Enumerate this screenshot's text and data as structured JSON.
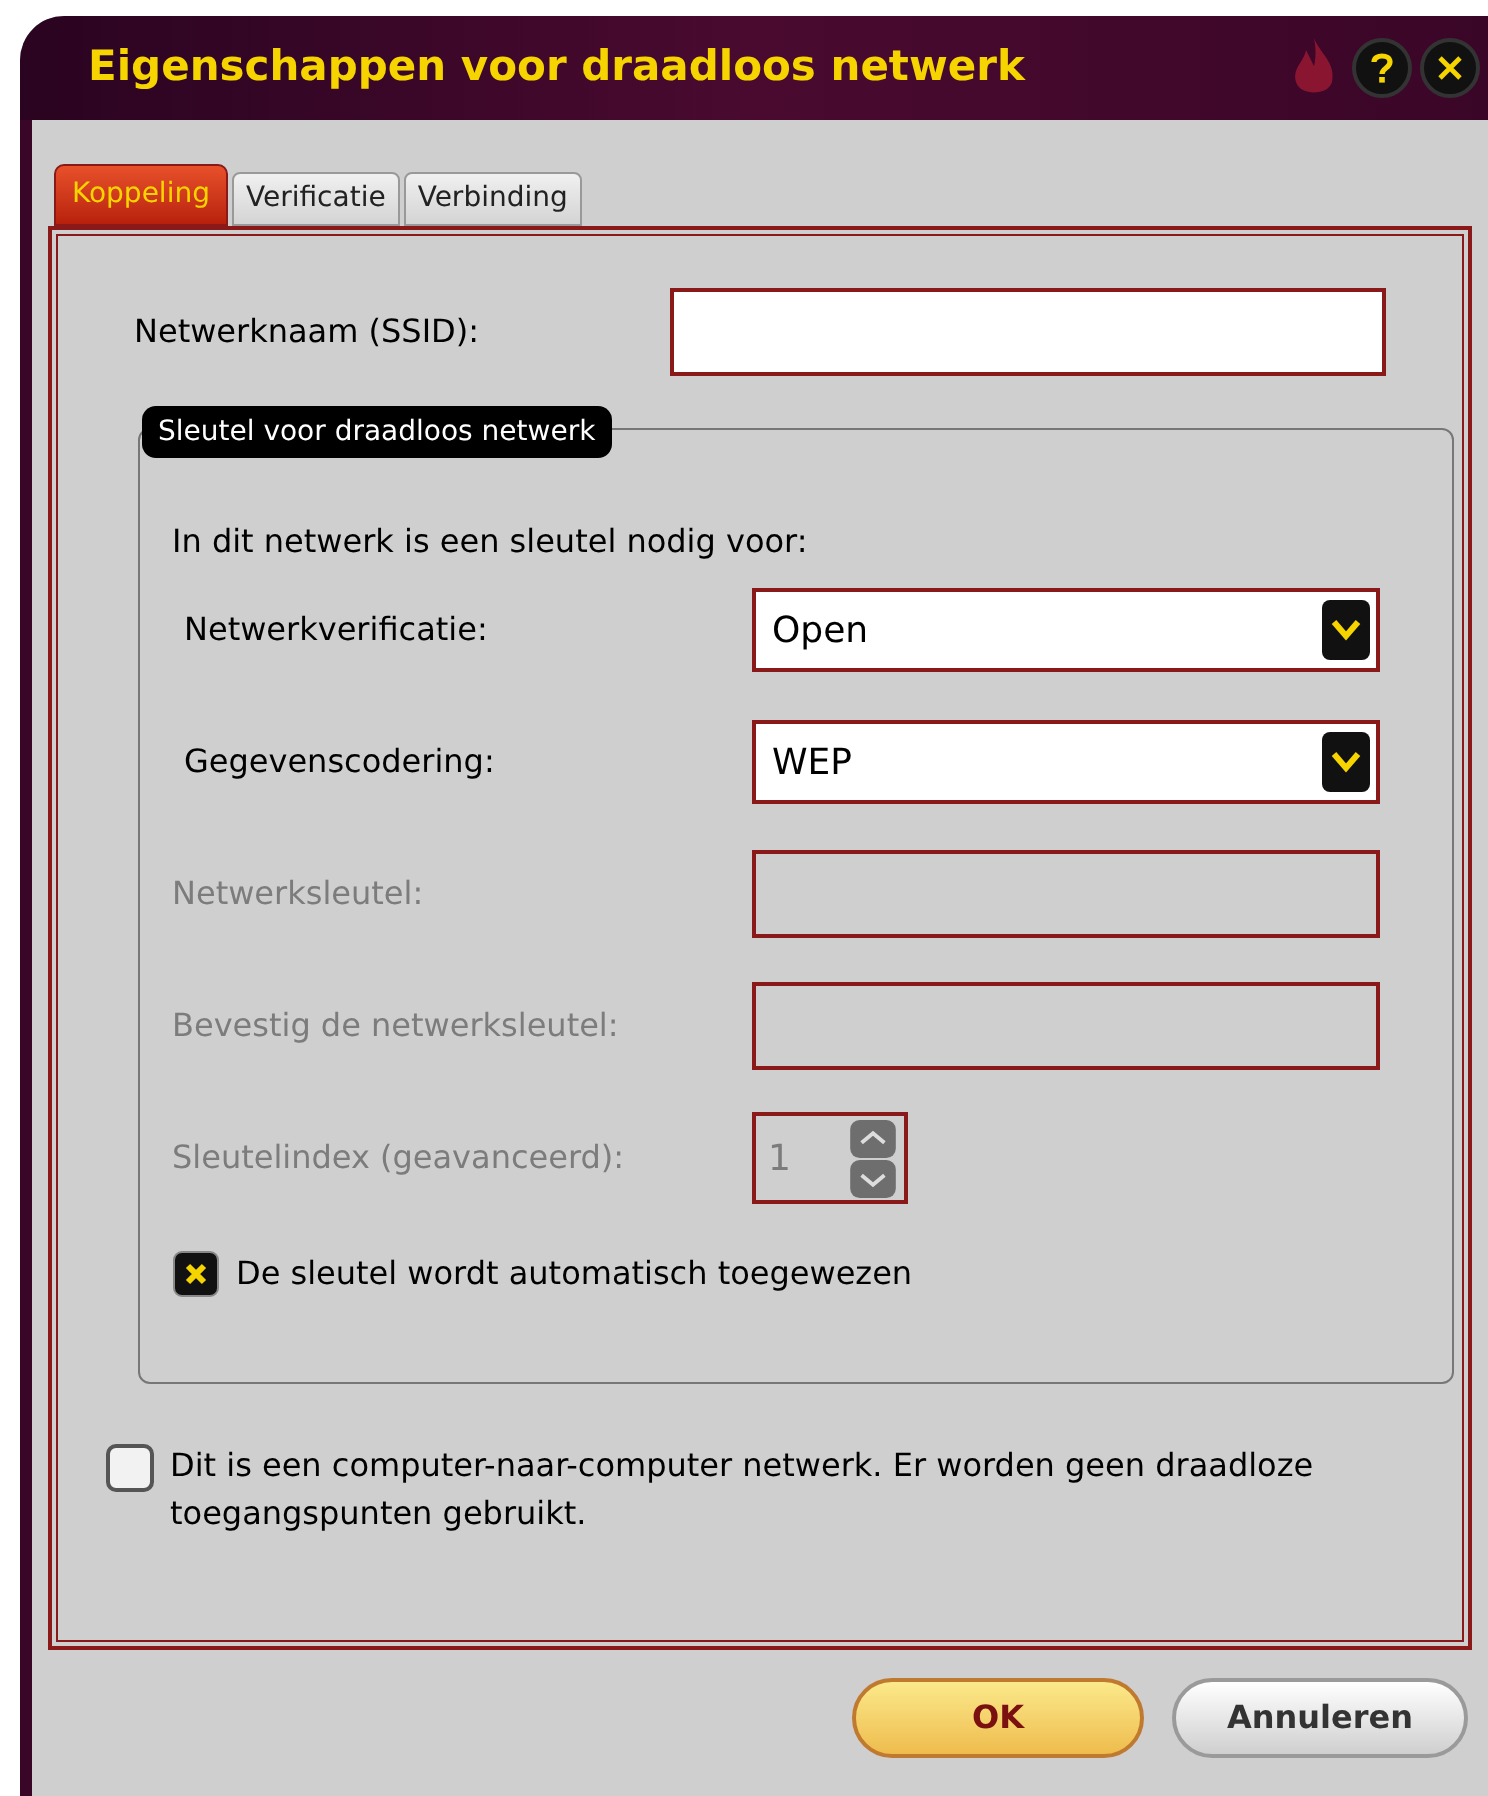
{
  "window": {
    "title": "Eigenschappen voor draadloos netwerk"
  },
  "tabs": [
    {
      "label": "Koppeling",
      "selected": true
    },
    {
      "label": "Verificatie",
      "selected": false
    },
    {
      "label": "Verbinding",
      "selected": false
    }
  ],
  "ssid": {
    "label": "Netwerknaam (SSID):"
  },
  "group": {
    "title": "Sleutel voor draadloos netwerk",
    "intro": "In dit netwerk is een sleutel nodig voor:",
    "rows": [
      {
        "kind": "select",
        "label": "Netwerkverificatie:",
        "value": "Open",
        "disabled": false
      },
      {
        "kind": "select",
        "label": "Gegevenscodering:",
        "value": "WEP",
        "disabled": false
      },
      {
        "kind": "text",
        "label": "Netwerksleutel:",
        "disabled": true
      },
      {
        "kind": "text",
        "label": "Bevestig de netwerksleutel:",
        "disabled": true
      },
      {
        "kind": "spin",
        "label": "Sleutelindex (geavanceerd):",
        "value": "1",
        "disabled": true
      }
    ],
    "auto_key": {
      "label": "De sleutel wordt automatisch toegewezen",
      "checked": true
    }
  },
  "adhoc": {
    "label": "Dit is een computer-naar-computer netwerk. Er worden geen draadloze toegangspunten gebruikt.",
    "checked": false
  },
  "buttons": [
    {
      "label": "OK",
      "kind": "default"
    },
    {
      "label": "Annuleren",
      "kind": "normal"
    }
  ]
}
